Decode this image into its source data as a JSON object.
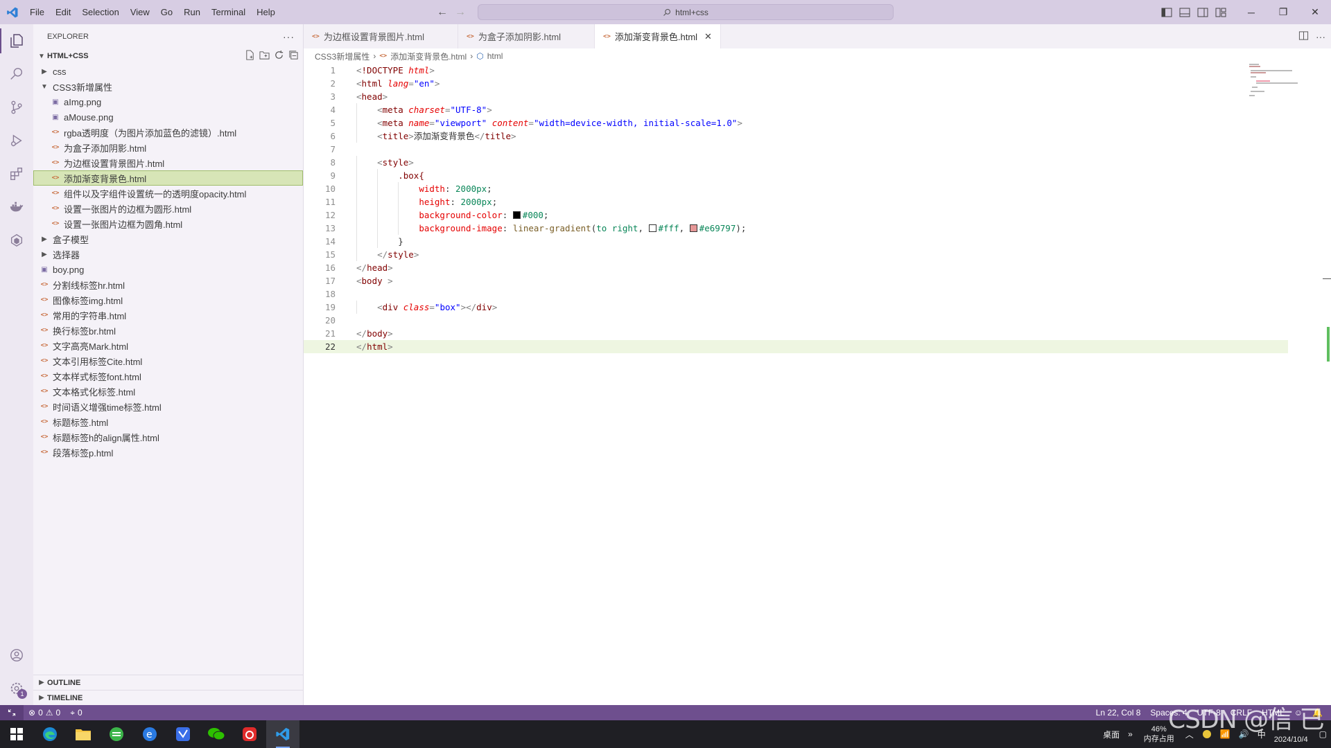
{
  "titlebar": {
    "menu": [
      "File",
      "Edit",
      "Selection",
      "View",
      "Go",
      "Run",
      "Terminal",
      "Help"
    ],
    "search": "html+css"
  },
  "sidebar": {
    "title": "EXPLORER",
    "root": "HTML+CSS",
    "tree": [
      {
        "label": "css",
        "type": "folder",
        "open": false,
        "depth": 1
      },
      {
        "label": "CSS3新增属性",
        "type": "folder",
        "open": true,
        "depth": 1
      },
      {
        "label": "aImg.png",
        "type": "image",
        "depth": 2
      },
      {
        "label": "aMouse.png",
        "type": "image",
        "depth": 2
      },
      {
        "label": "rgba透明度（为图片添加蓝色的滤镜）.html",
        "type": "html",
        "depth": 2
      },
      {
        "label": "为盒子添加阴影.html",
        "type": "html",
        "depth": 2
      },
      {
        "label": "为边框设置背景图片.html",
        "type": "html",
        "depth": 2
      },
      {
        "label": "添加渐变背景色.html",
        "type": "html",
        "depth": 2,
        "selected": true
      },
      {
        "label": "组件以及字组件设置统一的透明度opacity.html",
        "type": "html",
        "depth": 2
      },
      {
        "label": "设置一张图片的边框为圆形.html",
        "type": "html",
        "depth": 2
      },
      {
        "label": "设置一张图片边框为圆角.html",
        "type": "html",
        "depth": 2
      },
      {
        "label": "盒子模型",
        "type": "folder",
        "open": false,
        "depth": 1
      },
      {
        "label": "选择器",
        "type": "folder",
        "open": false,
        "depth": 1
      },
      {
        "label": "boy.png",
        "type": "image",
        "depth": 1
      },
      {
        "label": "分割线标签hr.html",
        "type": "html",
        "depth": 1
      },
      {
        "label": "图像标签img.html",
        "type": "html",
        "depth": 1
      },
      {
        "label": "常用的字符串.html",
        "type": "html",
        "depth": 1
      },
      {
        "label": "换行标签br.html",
        "type": "html",
        "depth": 1
      },
      {
        "label": "文字高亮Mark.html",
        "type": "html",
        "depth": 1
      },
      {
        "label": "文本引用标签Cite.html",
        "type": "html",
        "depth": 1
      },
      {
        "label": "文本样式标签font.html",
        "type": "html",
        "depth": 1
      },
      {
        "label": "文本格式化标签.html",
        "type": "html",
        "depth": 1
      },
      {
        "label": "时间语义增强time标签.html",
        "type": "html",
        "depth": 1
      },
      {
        "label": "标题标签.html",
        "type": "html",
        "depth": 1
      },
      {
        "label": "标题标签h的align属性.html",
        "type": "html",
        "depth": 1
      },
      {
        "label": "段落标签p.html",
        "type": "html",
        "depth": 1
      }
    ],
    "outline": "OUTLINE",
    "timeline": "TIMELINE"
  },
  "tabs": [
    {
      "label": "为边框设置背景图片.html",
      "active": false
    },
    {
      "label": "为盒子添加阴影.html",
      "active": false
    },
    {
      "label": "添加渐变背景色.html",
      "active": true
    }
  ],
  "breadcrumb": [
    "CSS3新增属性",
    "添加渐变背景色.html",
    "html"
  ],
  "code": [
    [
      [
        "p",
        "<"
      ],
      [
        "t",
        "!DOCTYPE"
      ],
      [
        "s",
        " "
      ],
      [
        "a",
        "html"
      ],
      [
        "p",
        ">"
      ]
    ],
    [
      [
        "p",
        "<"
      ],
      [
        "t",
        "html"
      ],
      [
        "s",
        " "
      ],
      [
        "a",
        "lang"
      ],
      [
        "p",
        "="
      ],
      [
        "v",
        "\"en\""
      ],
      [
        "p",
        ">"
      ]
    ],
    [
      [
        "p",
        "<"
      ],
      [
        "t",
        "head"
      ],
      [
        "p",
        ">"
      ]
    ],
    [
      [
        "s",
        "    "
      ],
      [
        "p",
        "<"
      ],
      [
        "t",
        "meta"
      ],
      [
        "s",
        " "
      ],
      [
        "a",
        "charset"
      ],
      [
        "p",
        "="
      ],
      [
        "v",
        "\"UTF-8\""
      ],
      [
        "p",
        ">"
      ]
    ],
    [
      [
        "s",
        "    "
      ],
      [
        "p",
        "<"
      ],
      [
        "t",
        "meta"
      ],
      [
        "s",
        " "
      ],
      [
        "a",
        "name"
      ],
      [
        "p",
        "="
      ],
      [
        "v",
        "\"viewport\""
      ],
      [
        "s",
        " "
      ],
      [
        "a",
        "content"
      ],
      [
        "p",
        "="
      ],
      [
        "v",
        "\"width=device-width, initial-scale=1.0\""
      ],
      [
        "p",
        ">"
      ]
    ],
    [
      [
        "s",
        "    "
      ],
      [
        "p",
        "<"
      ],
      [
        "t",
        "title"
      ],
      [
        "p",
        ">"
      ],
      [
        "x",
        "添加渐变背景色"
      ],
      [
        "p",
        "</"
      ],
      [
        "t",
        "title"
      ],
      [
        "p",
        ">"
      ]
    ],
    [],
    [
      [
        "s",
        "    "
      ],
      [
        "p",
        "<"
      ],
      [
        "t",
        "style"
      ],
      [
        "p",
        ">"
      ]
    ],
    [
      [
        "s",
        "        "
      ],
      [
        "c",
        ".box{"
      ]
    ],
    [
      [
        "s",
        "            "
      ],
      [
        "r",
        "width"
      ],
      [
        "x",
        ": "
      ],
      [
        "n",
        "2000px"
      ],
      [
        "x",
        ";"
      ]
    ],
    [
      [
        "s",
        "            "
      ],
      [
        "r",
        "height"
      ],
      [
        "x",
        ": "
      ],
      [
        "n",
        "2000px"
      ],
      [
        "x",
        ";"
      ]
    ],
    [
      [
        "s",
        "            "
      ],
      [
        "r",
        "background-color"
      ],
      [
        "x",
        ": "
      ],
      [
        "w",
        "#000"
      ],
      [
        "n",
        "#000"
      ],
      [
        "x",
        ";"
      ]
    ],
    [
      [
        "s",
        "            "
      ],
      [
        "r",
        "background-image"
      ],
      [
        "x",
        ": "
      ],
      [
        "f",
        "linear-gradient"
      ],
      [
        "x",
        "("
      ],
      [
        "n",
        "to right"
      ],
      [
        "x",
        ", "
      ],
      [
        "w",
        "#fff"
      ],
      [
        "n",
        "#fff"
      ],
      [
        "x",
        ", "
      ],
      [
        "w",
        "#e69797"
      ],
      [
        "n",
        "#e69797"
      ],
      [
        "x",
        ");"
      ]
    ],
    [
      [
        "s",
        "        "
      ],
      [
        "x",
        "}"
      ]
    ],
    [
      [
        "s",
        "    "
      ],
      [
        "p",
        "</"
      ],
      [
        "t",
        "style"
      ],
      [
        "p",
        ">"
      ]
    ],
    [
      [
        "p",
        "</"
      ],
      [
        "t",
        "head"
      ],
      [
        "p",
        ">"
      ]
    ],
    [
      [
        "p",
        "<"
      ],
      [
        "t",
        "body"
      ],
      [
        "s",
        " "
      ],
      [
        "p",
        ">"
      ]
    ],
    [],
    [
      [
        "s",
        "    "
      ],
      [
        "p",
        "<"
      ],
      [
        "t",
        "div"
      ],
      [
        "s",
        " "
      ],
      [
        "a",
        "class"
      ],
      [
        "p",
        "="
      ],
      [
        "v",
        "\"box\""
      ],
      [
        "p",
        "></"
      ],
      [
        "t",
        "div"
      ],
      [
        "p",
        ">"
      ]
    ],
    [],
    [
      [
        "p",
        "</"
      ],
      [
        "t",
        "body"
      ],
      [
        "p",
        ">"
      ]
    ],
    [
      [
        "p",
        "</"
      ],
      [
        "t",
        "html"
      ],
      [
        "p",
        ">"
      ]
    ]
  ],
  "current_line": 22,
  "status": {
    "errors": "0",
    "warnings": "0",
    "ports": "0",
    "position": "Ln 22, Col 8",
    "spaces": "Spaces: 4",
    "encoding": "UTF-8",
    "eol": "CRLF",
    "language": "HTML"
  },
  "taskbar": {
    "desktop": "桌面",
    "mem_percent": "46%",
    "mem_label": "内存占用",
    "date": "2024/10/4"
  },
  "watermark": "CSDN @信 已"
}
